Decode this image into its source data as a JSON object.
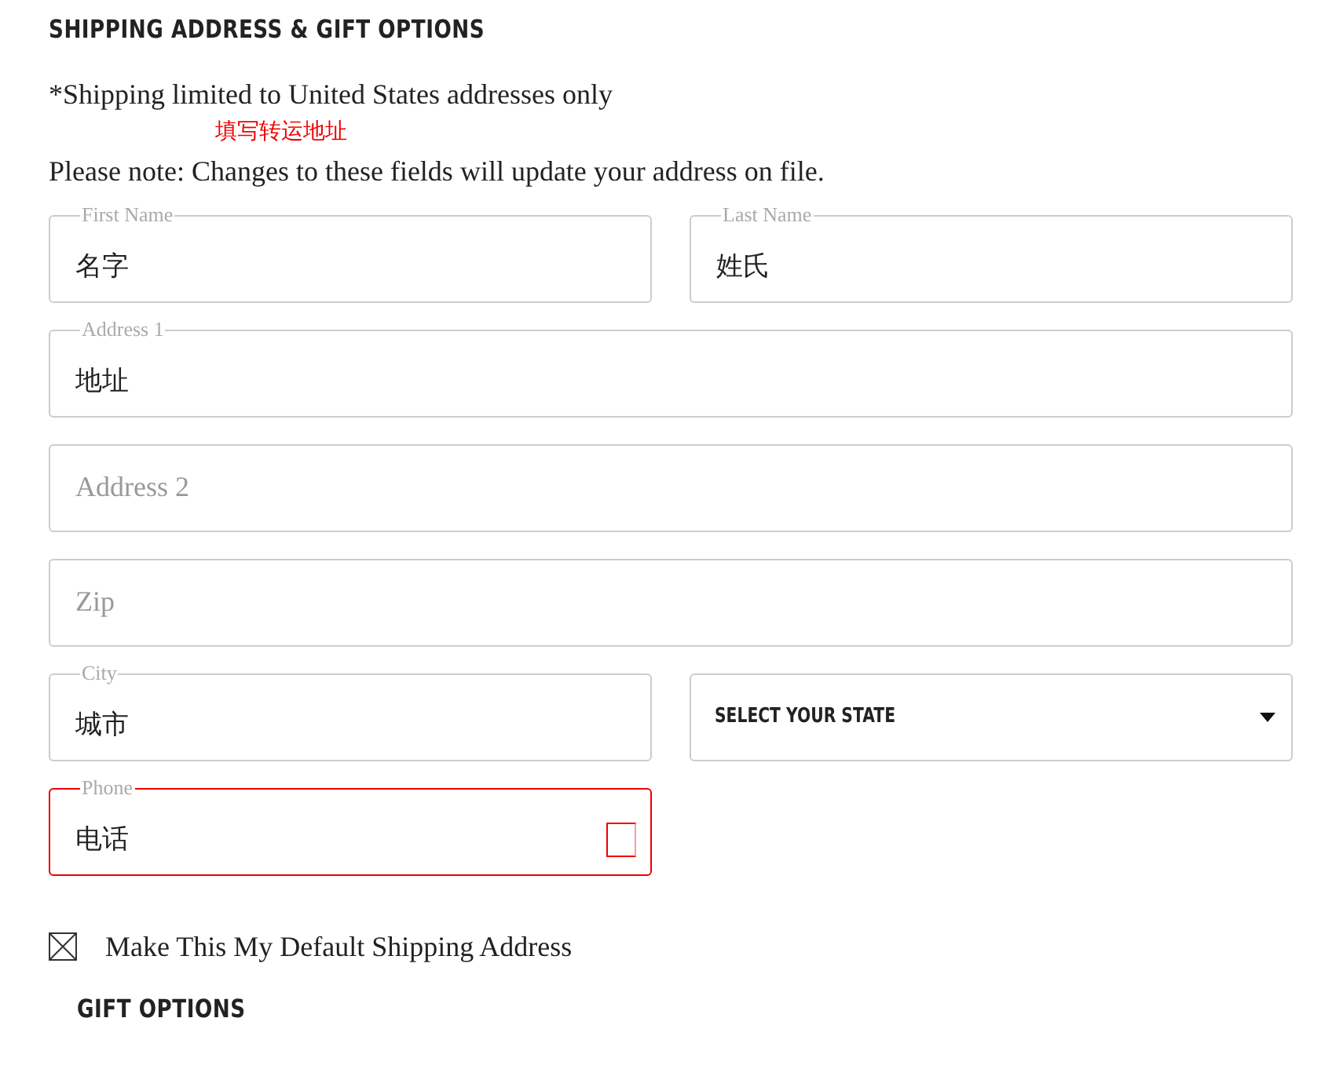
{
  "heading": "SHIPPING ADDRESS & GIFT OPTIONS",
  "notice": "*Shipping limited to United States addresses only",
  "annotation": "填写转运地址",
  "note": "Please note: Changes to these fields will update your address on file.",
  "rows": [
    [
      {
        "kind": "text",
        "label": "First Name",
        "value": "名字",
        "error": false
      },
      {
        "kind": "text",
        "label": "Last Name",
        "value": "姓氏",
        "error": false
      }
    ],
    [
      {
        "kind": "text",
        "label": "Address 1",
        "value": "地址",
        "error": false
      }
    ],
    [
      {
        "kind": "text",
        "placeholder": "Address 2",
        "error": false
      }
    ],
    [
      {
        "kind": "text",
        "placeholder": "Zip",
        "error": false
      }
    ],
    [
      {
        "kind": "text",
        "label": "City",
        "value": "城市",
        "error": false
      },
      {
        "kind": "select",
        "placeholder": "SELECT YOUR STATE"
      }
    ],
    [
      {
        "kind": "text",
        "label": "Phone",
        "value": "电话",
        "error": true
      },
      {
        "kind": "empty"
      }
    ]
  ],
  "default_address": {
    "label": "Make This My Default Shipping Address",
    "checked": true
  },
  "gift_heading": "GIFT OPTIONS"
}
